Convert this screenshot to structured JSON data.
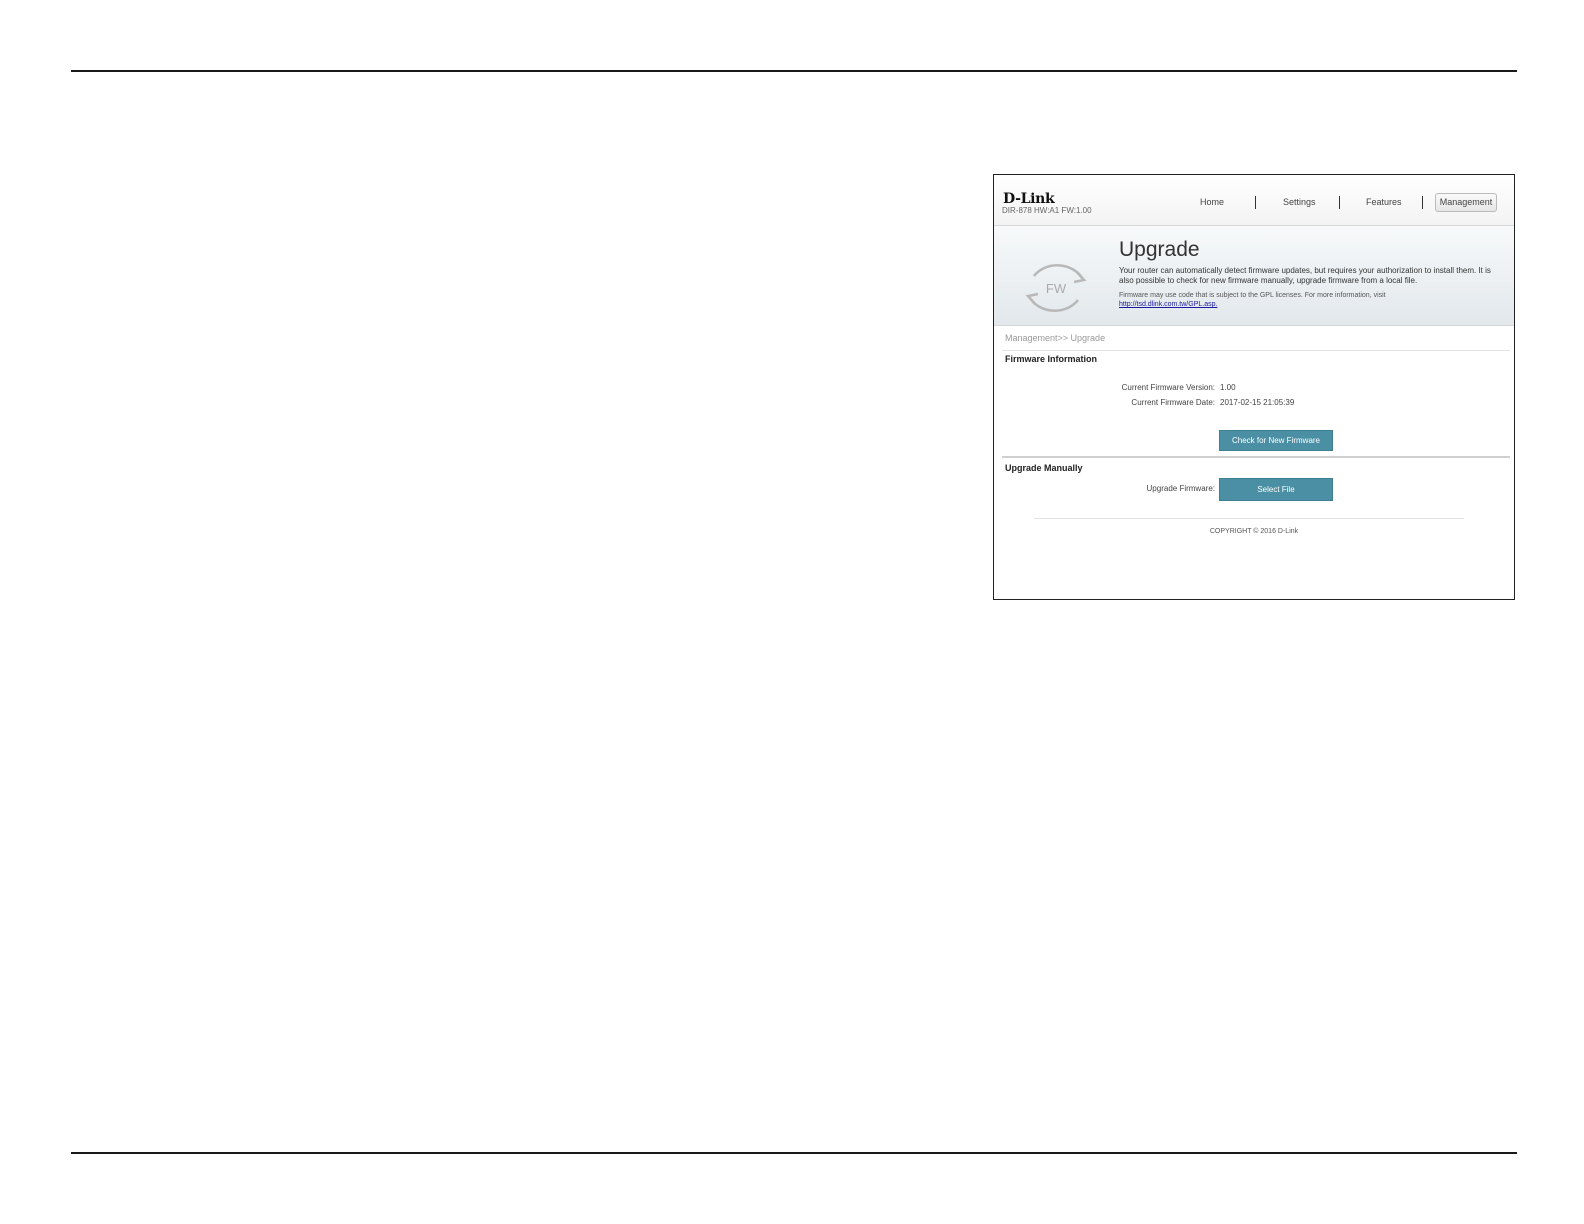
{
  "router": {
    "brand": "D-Link",
    "model_info": "DIR-878 HW:A1 FW:1.00",
    "nav": [
      {
        "label": "Home"
      },
      {
        "label": "Settings"
      },
      {
        "label": "Features"
      },
      {
        "label": "Management",
        "active": true
      }
    ],
    "banner": {
      "icon_name": "firmware-refresh-icon",
      "icon_text": "FW",
      "title": "Upgrade",
      "description": "Your router can automatically detect firmware updates, but requires your authorization to install them. It is also possible to check for new firmware manually, upgrade firmware from a local file.",
      "gpl_note": "Firmware may use code that is subject to the GPL licenses. For more information, visit",
      "gpl_link": "http://tsd.dlink.com.tw/GPL.asp."
    },
    "breadcrumb": "Management>> Upgrade",
    "firmware_info": {
      "heading": "Firmware Information",
      "version_label": "Current Firmware Version:",
      "version_value": "1.00",
      "date_label": "Current Firmware Date:",
      "date_value": "2017-02-15 21:05:39",
      "check_button": "Check for New Firmware"
    },
    "manual": {
      "heading": "Upgrade Manually",
      "upgrade_label": "Upgrade Firmware:",
      "select_button": "Select File"
    },
    "copyright": "COPYRIGHT © 2016 D-Link"
  },
  "colors": {
    "accent_button": "#4a8fa3",
    "link": "#1a1aa0",
    "rule": "#1a1a1a"
  }
}
